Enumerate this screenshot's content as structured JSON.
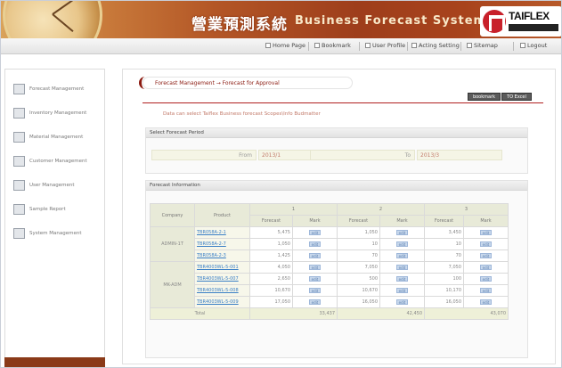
{
  "header": {
    "title_cn": "營業預測系統",
    "title_en": "Business Forecast System",
    "brand": "TAIFLEX"
  },
  "topnav": [
    {
      "label": "Home Page",
      "icon": "home-icon"
    },
    {
      "label": "Bookmark",
      "icon": "bookmark-icon"
    },
    {
      "label": "User Profile",
      "icon": "user-icon"
    },
    {
      "label": "Acting Setting",
      "icon": "settings-icon"
    },
    {
      "label": "Sitemap",
      "icon": "sitemap-icon"
    },
    {
      "label": "Logout",
      "icon": "logout-icon"
    }
  ],
  "sidebar": [
    {
      "label": "Forecast Management"
    },
    {
      "label": "Inventory Management"
    },
    {
      "label": "Material Management"
    },
    {
      "label": "Customer Management"
    },
    {
      "label": "User Management"
    },
    {
      "label": "Sample Report"
    },
    {
      "label": "System Management"
    }
  ],
  "main": {
    "breadcrumb": "Forecast Management → Forecast for Approval",
    "bookmark_btn": "bookmark",
    "excel_btn": "TO Excel",
    "hint": "Data can select Taiflex Business forecast Scopes\\Info Budmatter",
    "select_panel_title": "Select Forecast Period",
    "from_label": "From",
    "from_value": "2013/1",
    "to_label": "To",
    "to_value": "2013/3",
    "forecast_panel_title": "Forecast Information"
  },
  "table": {
    "col_company": "Company",
    "col_product": "Product",
    "months": [
      "1",
      "2",
      "3"
    ],
    "sub_forecast": "Forecast",
    "sub_mark": "Mark",
    "mark_label": "edit",
    "groups": [
      {
        "company": "ADMIN-1T",
        "rows": [
          {
            "product": "TBR058A-2-1",
            "vals": [
              "5,475",
              "1,050",
              "3,450"
            ]
          },
          {
            "product": "TBR058A-2-7",
            "vals": [
              "1,050",
              "10",
              "10"
            ]
          },
          {
            "product": "TBR058A-2-3",
            "vals": [
              "1,425",
              "70",
              "70"
            ]
          }
        ]
      },
      {
        "company": "MK-ADM",
        "rows": [
          {
            "product": "TBR4003WL-5-001",
            "vals": [
              "4,050",
              "7,050",
              "7,050"
            ]
          },
          {
            "product": "TBR4003WL-5-007",
            "vals": [
              "2,650",
              "500",
              "100"
            ]
          },
          {
            "product": "TBR4003WL-5-008",
            "vals": [
              "10,670",
              "10,670",
              "10,170"
            ]
          },
          {
            "product": "TBR4003WL-5-009",
            "vals": [
              "17,050",
              "16,050",
              "16,050"
            ]
          }
        ]
      }
    ],
    "total_label": "Total",
    "totals": [
      "33,437",
      "42,450",
      "43,070"
    ]
  }
}
